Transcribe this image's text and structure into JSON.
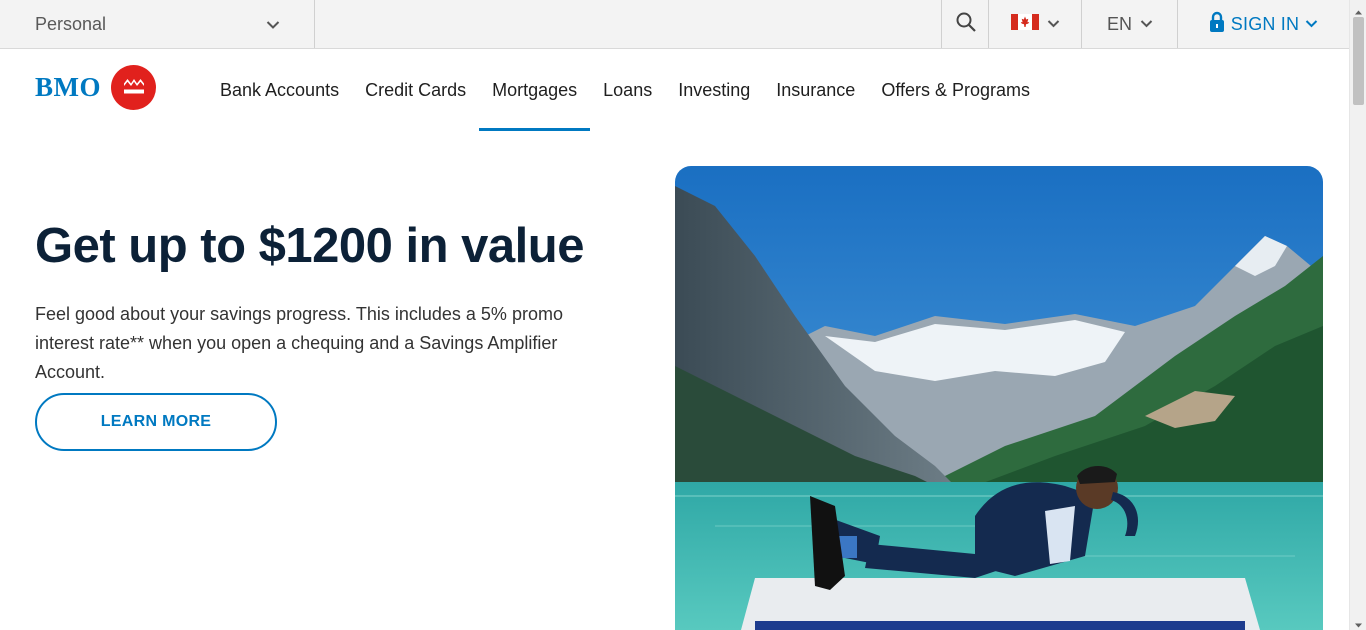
{
  "utility_bar": {
    "segment": "Personal",
    "language": "EN",
    "sign_in": "SIGN IN"
  },
  "icons": {
    "segment_chevron": "chevron-down-icon",
    "search": "search-icon",
    "flag": "canada-flag-icon",
    "flag_chevron": "chevron-down-icon",
    "language_chevron": "chevron-down-icon",
    "lock": "lock-icon",
    "sign_in_chevron": "chevron-down-icon"
  },
  "brand": {
    "name": "BMO",
    "color": "#0079c1",
    "roundel_color": "#e1211d"
  },
  "nav": {
    "items": [
      {
        "label": "Bank Accounts"
      },
      {
        "label": "Credit Cards"
      },
      {
        "label": "Mortgages",
        "active": true
      },
      {
        "label": "Loans"
      },
      {
        "label": "Investing"
      },
      {
        "label": "Insurance"
      },
      {
        "label": "Offers & Programs"
      }
    ]
  },
  "hero": {
    "title": "Get up to $1200 in value",
    "description": "Feel good about your savings progress. This includes a 5% promo interest rate** when you open a chequing and a Savings Amplifier Account.",
    "cta": "LEARN MORE"
  }
}
